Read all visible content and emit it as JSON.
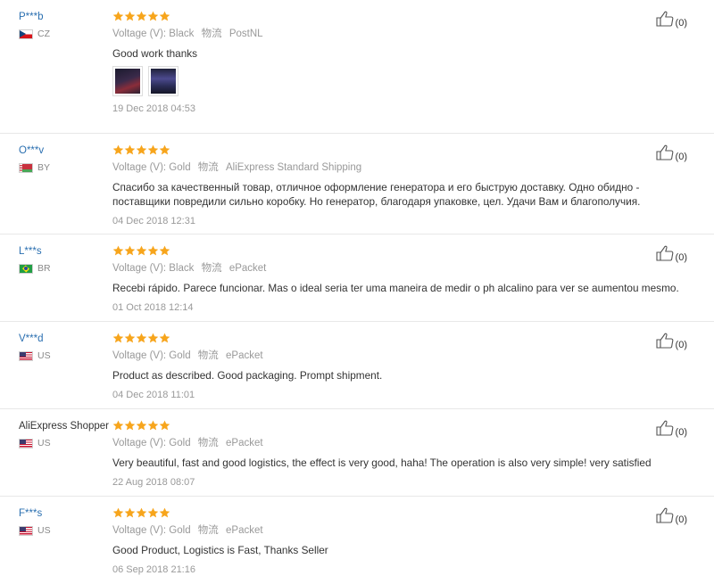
{
  "icons": {
    "rating": "star-icon",
    "helpful": "thumbs-up-icon",
    "country": "flag-icon"
  },
  "colors": {
    "star": "#f7a51c",
    "username": "#2a6fb0",
    "meta_text": "#999999"
  },
  "reviews": [
    {
      "user": "P***b",
      "country_code": "CZ",
      "flag": "cz",
      "rating": 5,
      "attribute_label": "Voltage (V):",
      "attribute_value": "Black",
      "logistics_label": "物流",
      "logistics_value": "PostNL",
      "text": "Good work thanks",
      "photo_count": 2,
      "date": "19 Dec 2018 04:53",
      "helpful_count": "(0)"
    },
    {
      "user": "O***v",
      "country_code": "BY",
      "flag": "by",
      "rating": 5,
      "attribute_label": "Voltage (V):",
      "attribute_value": "Gold",
      "logistics_label": "物流",
      "logistics_value": "AliExpress Standard Shipping",
      "text": "Спасибо за качественный товар, отличное оформление генератора и его быструю доставку. Одно обидно - поставщики повредили сильно коробку. Но генератор, благодаря упаковке, цел. Удачи Вам и благополучия.",
      "photo_count": 0,
      "date": "04 Dec 2018 12:31",
      "helpful_count": "(0)"
    },
    {
      "user": "L***s",
      "country_code": "BR",
      "flag": "br",
      "rating": 5,
      "attribute_label": "Voltage (V):",
      "attribute_value": "Black",
      "logistics_label": "物流",
      "logistics_value": "ePacket",
      "text": "Recebi rápido. Parece funcionar. Mas o ideal seria ter uma maneira de medir o ph alcalino para ver se aumentou mesmo.",
      "photo_count": 0,
      "date": "01 Oct 2018 12:14",
      "helpful_count": "(0)"
    },
    {
      "user": "V***d",
      "country_code": "US",
      "flag": "us",
      "rating": 5,
      "attribute_label": "Voltage (V):",
      "attribute_value": "Gold",
      "logistics_label": "物流",
      "logistics_value": "ePacket",
      "text": "Product as described. Good packaging. Prompt shipment.",
      "photo_count": 0,
      "date": "04 Dec 2018 11:01",
      "helpful_count": "(0)"
    },
    {
      "user": "AliExpress Shopper",
      "country_code": "US",
      "flag": "us",
      "rating": 5,
      "attribute_label": "Voltage (V):",
      "attribute_value": "Gold",
      "logistics_label": "物流",
      "logistics_value": "ePacket",
      "text": "Very beautiful, fast and good logistics, the effect is very good, haha! The operation is also very simple! very satisfied",
      "photo_count": 0,
      "date": "22 Aug 2018 08:07",
      "helpful_count": "(0)"
    },
    {
      "user": "F***s",
      "country_code": "US",
      "flag": "us",
      "rating": 5,
      "attribute_label": "Voltage (V):",
      "attribute_value": "Gold",
      "logistics_label": "物流",
      "logistics_value": "ePacket",
      "text": "Good Product, Logistics is Fast, Thanks Seller",
      "photo_count": 0,
      "date": "06 Sep 2018 21:16",
      "helpful_count": "(0)"
    }
  ]
}
